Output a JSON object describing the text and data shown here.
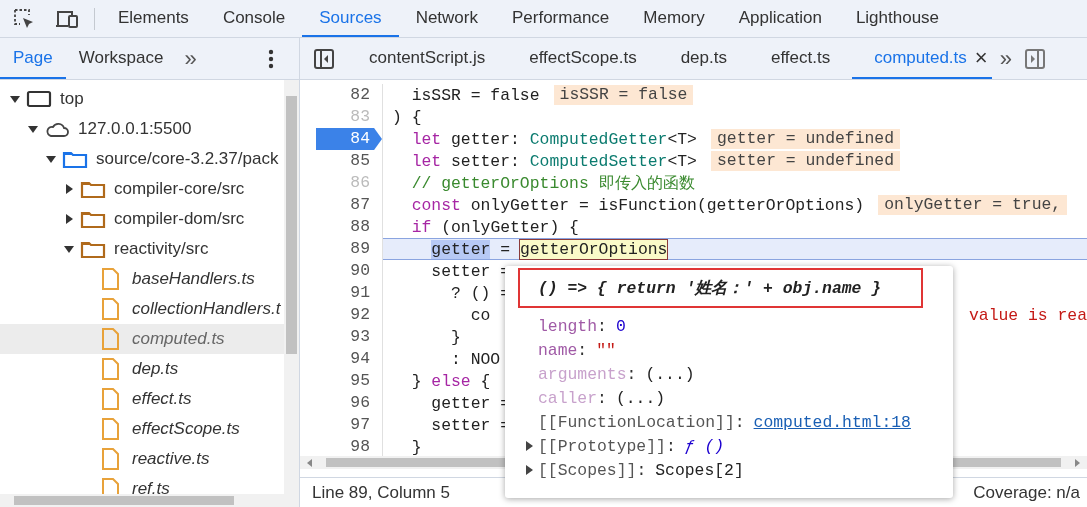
{
  "main_tabs": [
    {
      "label": "Elements",
      "selected": false
    },
    {
      "label": "Console",
      "selected": false
    },
    {
      "label": "Sources",
      "selected": true
    },
    {
      "label": "Network",
      "selected": false
    },
    {
      "label": "Performance",
      "selected": false
    },
    {
      "label": "Memory",
      "selected": false
    },
    {
      "label": "Application",
      "selected": false
    },
    {
      "label": "Lighthouse",
      "selected": false
    }
  ],
  "sidebar": {
    "tabs": [
      {
        "label": "Page",
        "selected": true
      },
      {
        "label": "Workspace",
        "selected": false
      }
    ],
    "more": "»",
    "tree": [
      {
        "kind": "frame",
        "label": "top",
        "expanded": true,
        "selected": false,
        "children": [
          {
            "kind": "domain",
            "label": "127.0.0.1:5500",
            "expanded": true,
            "selected": false,
            "children": [
              {
                "kind": "root-folder",
                "label": "source/core-3.2.37/pack",
                "expanded": true,
                "selected": false,
                "children": [
                  {
                    "kind": "folder",
                    "label": "compiler-core/src",
                    "expanded": false,
                    "selected": false
                  },
                  {
                    "kind": "folder",
                    "label": "compiler-dom/src",
                    "expanded": false,
                    "selected": false
                  },
                  {
                    "kind": "folder",
                    "label": "reactivity/src",
                    "expanded": true,
                    "selected": false,
                    "children": [
                      {
                        "kind": "file",
                        "label": "baseHandlers.ts",
                        "selected": false
                      },
                      {
                        "kind": "file",
                        "label": "collectionHandlers.t",
                        "selected": false
                      },
                      {
                        "kind": "file",
                        "label": "computed.ts",
                        "selected": true
                      },
                      {
                        "kind": "file",
                        "label": "dep.ts",
                        "selected": false
                      },
                      {
                        "kind": "file",
                        "label": "effect.ts",
                        "selected": false
                      },
                      {
                        "kind": "file",
                        "label": "effectScope.ts",
                        "selected": false
                      },
                      {
                        "kind": "file",
                        "label": "reactive.ts",
                        "selected": false
                      },
                      {
                        "kind": "file",
                        "label": "ref.ts",
                        "selected": false
                      }
                    ]
                  }
                ]
              }
            ]
          }
        ]
      }
    ]
  },
  "editor": {
    "tabs": [
      {
        "label": "contentScript.js",
        "selected": false
      },
      {
        "label": "effectScope.ts",
        "selected": false
      },
      {
        "label": "dep.ts",
        "selected": false
      },
      {
        "label": "effect.ts",
        "selected": false
      },
      {
        "label": "computed.ts",
        "selected": true,
        "close": "×"
      }
    ],
    "more": "»",
    "lines": [
      {
        "number": "82",
        "dim": false,
        "breakpoint": false,
        "current": false,
        "segments": [
          {
            "kind": "plain",
            "text": "  isSSR = false"
          }
        ],
        "badge": "isSSR = false"
      },
      {
        "number": "83",
        "dim": true,
        "breakpoint": false,
        "current": false,
        "segments": [
          {
            "kind": "plain",
            "text": ") {"
          }
        ]
      },
      {
        "number": "84",
        "dim": false,
        "breakpoint": true,
        "current": false,
        "segments": [
          {
            "kind": "keyword",
            "text": "  let"
          },
          {
            "kind": "plain",
            "text": " getter: "
          },
          {
            "kind": "type",
            "text": "ComputedGetter"
          },
          {
            "kind": "plain",
            "text": "<T>"
          }
        ],
        "badge": "getter = undefined"
      },
      {
        "number": "85",
        "dim": false,
        "breakpoint": false,
        "current": false,
        "segments": [
          {
            "kind": "keyword",
            "text": "  let"
          },
          {
            "kind": "plain",
            "text": " setter: "
          },
          {
            "kind": "type",
            "text": "ComputedSetter"
          },
          {
            "kind": "plain",
            "text": "<T>"
          }
        ],
        "badge": "setter = undefined"
      },
      {
        "number": "86",
        "dim": true,
        "breakpoint": false,
        "current": false,
        "segments": [
          {
            "kind": "comment",
            "text": "  // getterOrOptions 即传入的函数"
          }
        ]
      },
      {
        "number": "87",
        "dim": false,
        "breakpoint": false,
        "current": false,
        "segments": [
          {
            "kind": "keyword",
            "text": "  const"
          },
          {
            "kind": "plain",
            "text": " onlyGetter = isFunction(getterOrOptions)"
          }
        ],
        "badge": "onlyGetter = true,"
      },
      {
        "number": "88",
        "dim": false,
        "breakpoint": false,
        "current": false,
        "segments": [
          {
            "kind": "keyword",
            "text": "  if"
          },
          {
            "kind": "plain",
            "text": " (onlyGetter) {"
          }
        ]
      },
      {
        "number": "89",
        "dim": false,
        "breakpoint": false,
        "current": true,
        "segments": [
          {
            "kind": "selection",
            "text": "    getter"
          },
          {
            "kind": "plain",
            "text": " = "
          },
          {
            "kind": "hover",
            "text": "getterOrOptions"
          }
        ]
      },
      {
        "number": "90",
        "dim": false,
        "breakpoint": false,
        "current": false,
        "segments": [
          {
            "kind": "plain",
            "text": "    setter ="
          }
        ]
      },
      {
        "number": "91",
        "dim": false,
        "breakpoint": false,
        "current": false,
        "segments": [
          {
            "kind": "plain",
            "text": "      ? () ="
          }
        ]
      },
      {
        "number": "92",
        "dim": false,
        "breakpoint": false,
        "current": false,
        "segments": [
          {
            "kind": "plain",
            "text": "        co"
          }
        ],
        "trailing": "value is rea"
      },
      {
        "number": "93",
        "dim": false,
        "breakpoint": false,
        "current": false,
        "segments": [
          {
            "kind": "plain",
            "text": "      }"
          }
        ]
      },
      {
        "number": "94",
        "dim": false,
        "breakpoint": false,
        "current": false,
        "segments": [
          {
            "kind": "plain",
            "text": "      : NOO"
          }
        ]
      },
      {
        "number": "95",
        "dim": false,
        "breakpoint": false,
        "current": false,
        "segments": [
          {
            "kind": "plain",
            "text": "  } "
          },
          {
            "kind": "keyword",
            "text": "else"
          },
          {
            "kind": "plain",
            "text": " {"
          }
        ]
      },
      {
        "number": "96",
        "dim": false,
        "breakpoint": false,
        "current": false,
        "segments": [
          {
            "kind": "plain",
            "text": "    getter ="
          }
        ]
      },
      {
        "number": "97",
        "dim": false,
        "breakpoint": false,
        "current": false,
        "segments": [
          {
            "kind": "plain",
            "text": "    setter ="
          }
        ]
      },
      {
        "number": "98",
        "dim": false,
        "breakpoint": false,
        "current": false,
        "segments": [
          {
            "kind": "plain",
            "text": "  }"
          }
        ]
      }
    ],
    "status": {
      "position": "Line 89, Column 5",
      "coverage": "Coverage: n/a"
    }
  },
  "popover": {
    "title": "() => { return '姓名：' + obj.name }",
    "annotated": true,
    "rows": [
      {
        "kind": "property",
        "name": "length",
        "separator": ":",
        "value": {
          "kind": "number",
          "text": "0"
        },
        "dim": false
      },
      {
        "kind": "property",
        "name": "name",
        "separator": ":",
        "value": {
          "kind": "string",
          "text": "\"\""
        },
        "dim": false
      },
      {
        "kind": "property",
        "name": "arguments",
        "separator": ":",
        "value": {
          "kind": "plain",
          "text": "(...)"
        },
        "dim": true
      },
      {
        "kind": "property",
        "name": "caller",
        "separator": ":",
        "value": {
          "kind": "plain",
          "text": "(...)"
        },
        "dim": true
      },
      {
        "kind": "internal",
        "name": "[[FunctionLocation]]",
        "separator": ":",
        "value": {
          "kind": "link",
          "text": "computed.html:18"
        }
      },
      {
        "kind": "expandable",
        "name": "[[Prototype]]",
        "separator": ":",
        "value": {
          "kind": "function",
          "text": "ƒ ()"
        },
        "expanded": false
      },
      {
        "kind": "expandable",
        "name": "[[Scopes]]",
        "separator": ":",
        "value": {
          "kind": "plain",
          "text": "Scopes[2]"
        },
        "expanded": false
      }
    ]
  }
}
